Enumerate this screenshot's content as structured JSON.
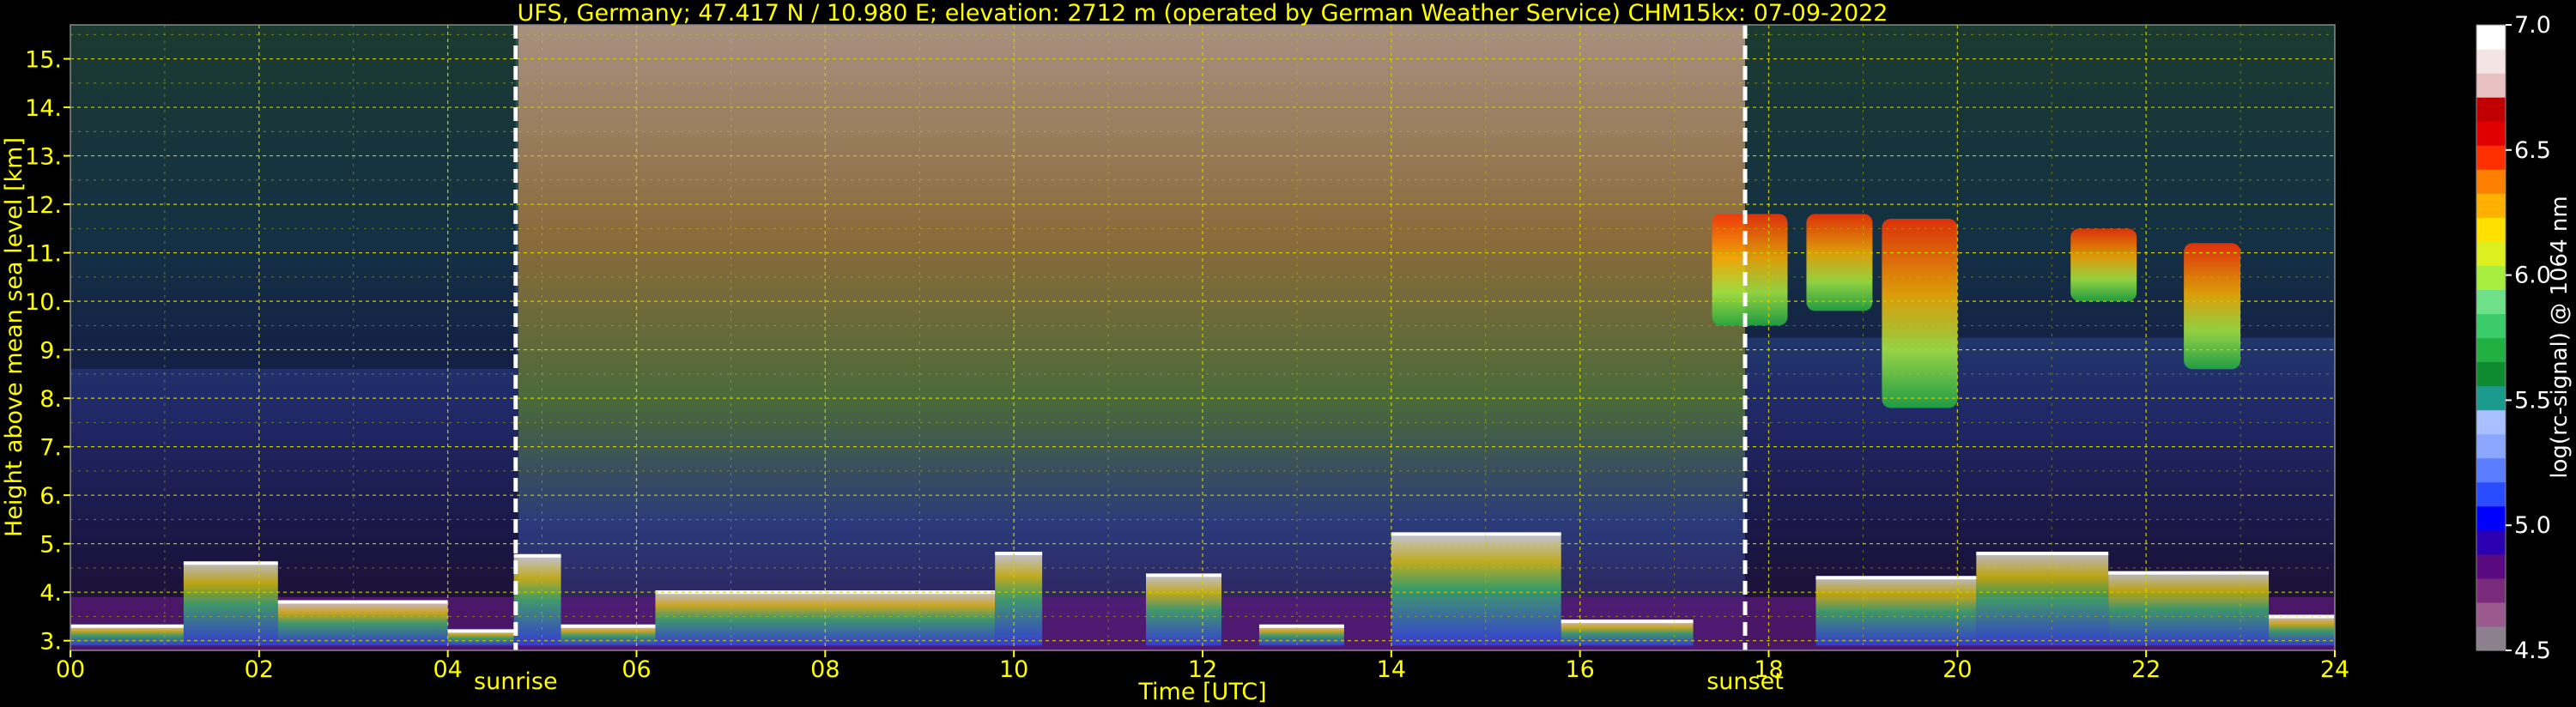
{
  "chart_data": {
    "type": "heatmap",
    "title": "UFS, Germany; 47.417 N / 10.980 E; elevation: 2712 m  (operated by German Weather Service)    CHM15kx: 07-09-2022",
    "xlabel": "Time [UTC]",
    "ylabel": "Height above mean sea level [km]",
    "xlim": [
      0,
      24
    ],
    "ylim": [
      2.8,
      15.7
    ],
    "x_ticks": [
      0,
      2,
      4,
      6,
      8,
      10,
      12,
      14,
      16,
      18,
      20,
      22,
      24
    ],
    "x_tick_labels": [
      "00",
      "02",
      "04",
      "06",
      "08",
      "10",
      "12",
      "14",
      "16",
      "18",
      "20",
      "22",
      "24"
    ],
    "y_ticks": [
      3,
      4,
      5,
      6,
      7,
      8,
      9,
      10,
      11,
      12,
      13,
      14,
      15
    ],
    "y_tick_labels": [
      "3.",
      "4.",
      "5.",
      "6.",
      "7.",
      "8.",
      "9.",
      "10.",
      "11.",
      "12.",
      "13.",
      "14.",
      "15."
    ],
    "grid": true,
    "markers": [
      {
        "label": "sunrise",
        "x": 4.72
      },
      {
        "label": "sunset",
        "x": 17.75
      }
    ],
    "colorbar": {
      "label": "log(rc-signal) @ 1064 nm",
      "range": [
        4.5,
        7.0
      ],
      "ticks": [
        4.5,
        5.0,
        5.5,
        6.0,
        6.5,
        7.0
      ],
      "tick_labels": [
        "4.5",
        "5.0",
        "5.5",
        "6.0",
        "6.5",
        "7.0"
      ],
      "colors": [
        "#8c7f8e",
        "#9a5a8e",
        "#7a2a7a",
        "#5a0a80",
        "#2a00b0",
        "#0000ff",
        "#2a4cff",
        "#5a7dff",
        "#8aa6ff",
        "#a8c0ff",
        "#1a9a8a",
        "#0e8a30",
        "#22b040",
        "#3acc6a",
        "#6ee08a",
        "#a8ee40",
        "#dcf020",
        "#ffe000",
        "#ffb000",
        "#ff8000",
        "#ff3000",
        "#e00000",
        "#c00000",
        "#e8c0c0",
        "#f4e4e4",
        "#ffffff"
      ]
    },
    "cloud_layers": [
      {
        "t0": 0.0,
        "t1": 1.2,
        "h": 3.3
      },
      {
        "t0": 1.2,
        "t1": 2.2,
        "h": 4.6
      },
      {
        "t0": 2.2,
        "t1": 4.0,
        "h": 3.8
      },
      {
        "t0": 4.0,
        "t1": 4.7,
        "h": 3.2
      },
      {
        "t0": 4.7,
        "t1": 5.2,
        "h": 4.75
      },
      {
        "t0": 5.2,
        "t1": 6.2,
        "h": 3.3
      },
      {
        "t0": 6.2,
        "t1": 9.8,
        "h": 4.0
      },
      {
        "t0": 9.8,
        "t1": 10.3,
        "h": 4.8
      },
      {
        "t0": 11.4,
        "t1": 12.2,
        "h": 4.35
      },
      {
        "t0": 12.6,
        "t1": 13.5,
        "h": 3.3
      },
      {
        "t0": 14.0,
        "t1": 15.8,
        "h": 5.2
      },
      {
        "t0": 15.8,
        "t1": 17.2,
        "h": 3.4
      },
      {
        "t0": 18.5,
        "t1": 20.2,
        "h": 4.3
      },
      {
        "t0": 20.2,
        "t1": 21.6,
        "h": 4.8
      },
      {
        "t0": 21.6,
        "t1": 23.3,
        "h": 4.4
      },
      {
        "t0": 23.3,
        "t1": 24.0,
        "h": 3.5
      }
    ],
    "cirrus": [
      {
        "t0": 17.4,
        "t1": 18.2,
        "h0": 9.5,
        "h1": 11.8
      },
      {
        "t0": 18.4,
        "t1": 19.1,
        "h0": 9.8,
        "h1": 11.8
      },
      {
        "t0": 19.2,
        "t1": 20.0,
        "h0": 7.8,
        "h1": 11.7
      },
      {
        "t0": 21.2,
        "t1": 21.9,
        "h0": 10.0,
        "h1": 11.5
      },
      {
        "t0": 22.4,
        "t1": 23.0,
        "h0": 8.6,
        "h1": 11.2
      }
    ]
  }
}
